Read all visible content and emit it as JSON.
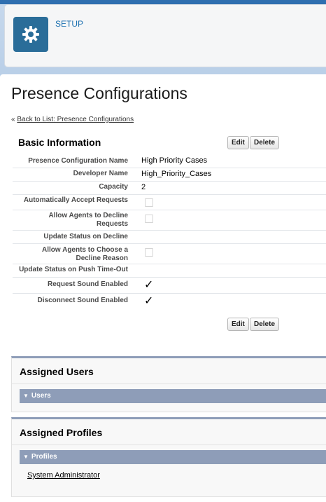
{
  "header": {
    "setup_label": "SETUP",
    "icon": "gear-icon"
  },
  "page": {
    "title": "Presence Configurations",
    "back_prefix": "«",
    "back_link": "Back to List: Presence Configurations"
  },
  "basic_info": {
    "title": "Basic Information",
    "edit_label": "Edit",
    "delete_label": "Delete",
    "fields": {
      "config_name": {
        "label": "Presence Configuration Name",
        "value": "High Priority Cases"
      },
      "developer_name": {
        "label": "Developer Name",
        "value": "High_Priority_Cases"
      },
      "capacity": {
        "label": "Capacity",
        "value": "2"
      },
      "auto_accept": {
        "label": "Automatically Accept Requests",
        "checked": false
      },
      "allow_decline": {
        "label": "Allow Agents to Decline Requests",
        "checked": false
      },
      "status_on_decline": {
        "label": "Update Status on Decline",
        "value": ""
      },
      "choose_decline_reason": {
        "label": "Allow Agents to Choose a Decline Reason",
        "checked": false
      },
      "status_push_timeout": {
        "label": "Update Status on Push Time-Out",
        "value": ""
      },
      "request_sound": {
        "label": "Request Sound Enabled",
        "checked": true,
        "mark": "✓"
      },
      "disconnect_sound": {
        "label": "Disconnect Sound Enabled",
        "checked": true,
        "mark": "✓"
      }
    }
  },
  "assigned_users": {
    "title": "Assigned Users",
    "subsection": "Users",
    "toggle": "▼"
  },
  "assigned_profiles": {
    "title": "Assigned Profiles",
    "subsection": "Profiles",
    "toggle": "▼",
    "items": [
      "System Administrator"
    ]
  },
  "colors": {
    "accent_blue": "#2a6d99",
    "section_bar": "#8e9db8",
    "link": "#1a6fb0"
  }
}
